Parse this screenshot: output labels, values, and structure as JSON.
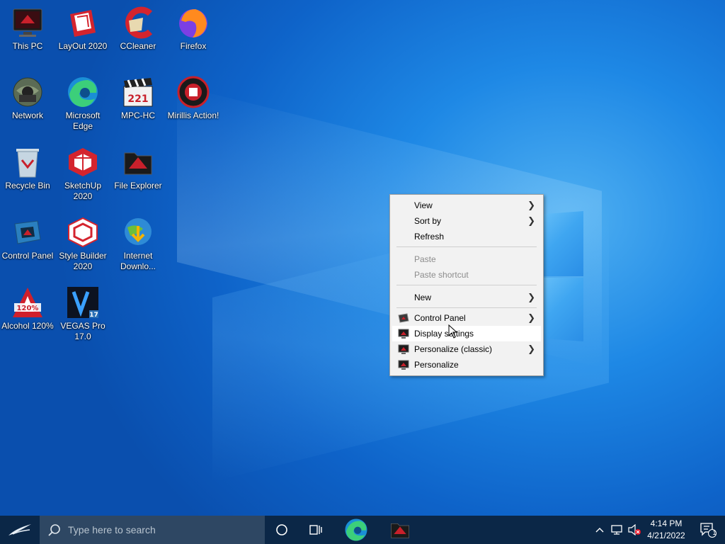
{
  "desktop": {
    "icons": [
      {
        "label": "This PC"
      },
      {
        "label": "LayOut 2020"
      },
      {
        "label": "CCleaner"
      },
      {
        "label": "Firefox"
      },
      {
        "label": "Network"
      },
      {
        "label": "Microsoft Edge"
      },
      {
        "label": "MPC-HC"
      },
      {
        "label": "Mirillis Action!"
      },
      {
        "label": "Recycle Bin"
      },
      {
        "label": "SketchUp 2020"
      },
      {
        "label": "File Explorer"
      },
      {
        "label": "Control Panel"
      },
      {
        "label": "Style Builder 2020"
      },
      {
        "label": "Internet Downlo..."
      },
      {
        "label": "Alcohol 120%"
      },
      {
        "label": "VEGAS Pro 17.0"
      }
    ]
  },
  "context_menu": {
    "items": [
      {
        "label": "View",
        "submenu": true,
        "disabled": false
      },
      {
        "label": "Sort by",
        "submenu": true,
        "disabled": false
      },
      {
        "label": "Refresh",
        "submenu": false,
        "disabled": false
      },
      {
        "label": "Paste",
        "submenu": false,
        "disabled": true
      },
      {
        "label": "Paste shortcut",
        "submenu": false,
        "disabled": true
      },
      {
        "label": "New",
        "submenu": true,
        "disabled": false
      },
      {
        "label": "Control Panel",
        "submenu": true,
        "icon": "control-panel-icon"
      },
      {
        "label": "Display settings",
        "submenu": false,
        "icon": "display-icon",
        "highlighted": true
      },
      {
        "label": "Personalize (classic)",
        "submenu": true,
        "icon": "personalize-icon"
      },
      {
        "label": "Personalize",
        "submenu": false,
        "icon": "personalize-icon"
      }
    ]
  },
  "taskbar": {
    "search_placeholder": "Type here to search",
    "time": "4:14 PM",
    "date": "4/21/2022",
    "notification_count": "1"
  },
  "colors": {
    "taskbar": "#0b2747",
    "search_box": "#2e4763",
    "menu_bg": "#f2f2f2",
    "desktop_blue": "#1e88e5"
  }
}
